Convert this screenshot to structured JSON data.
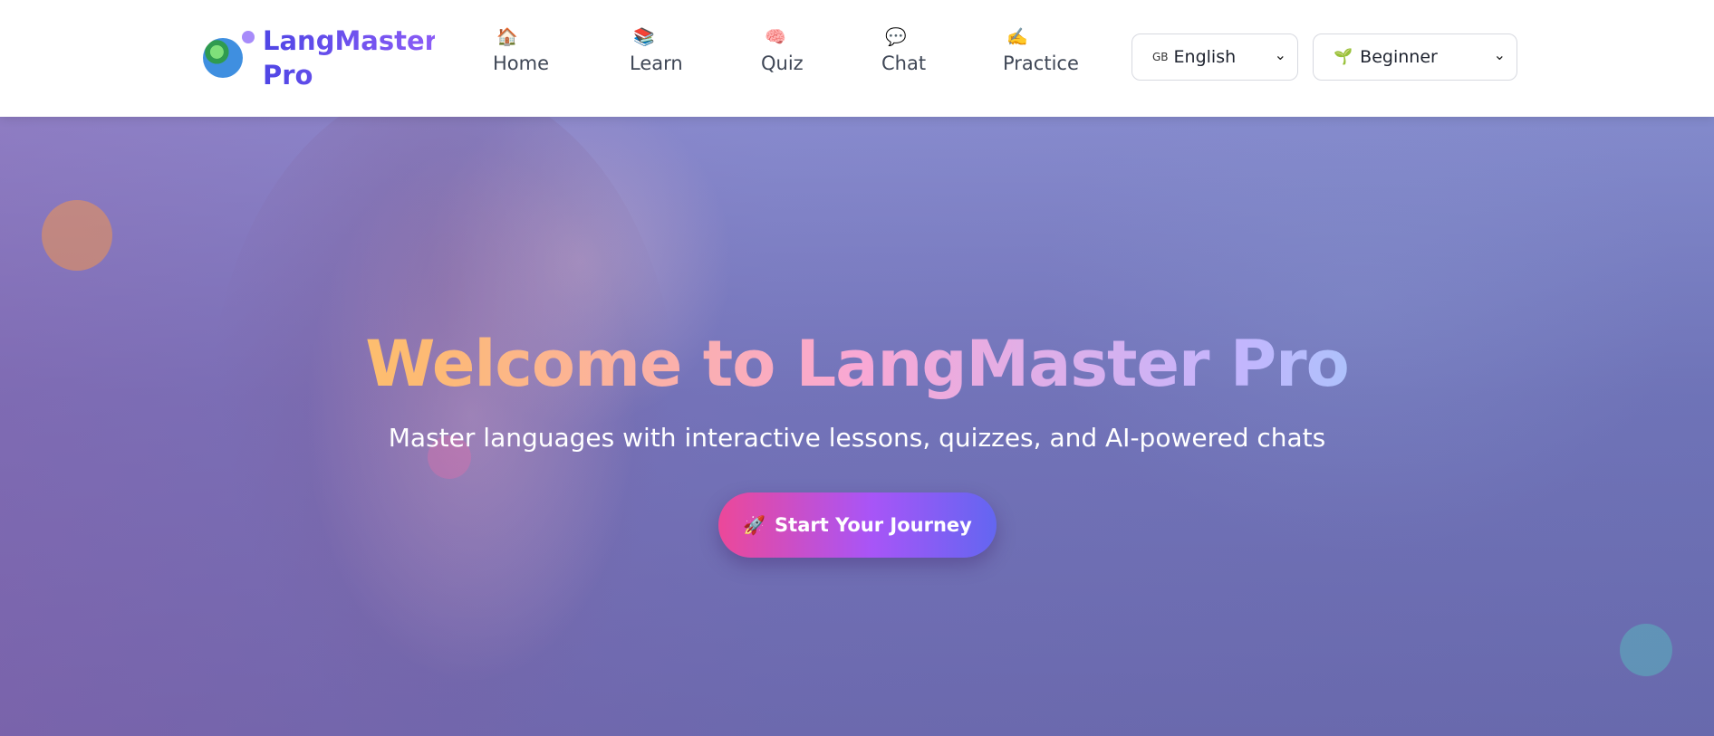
{
  "brand": {
    "name": "LangMaster Pro",
    "logo_icon": "globe-icon"
  },
  "nav": [
    {
      "icon": "🏠",
      "icon_name": "home-icon",
      "label": "Home"
    },
    {
      "icon": "📚",
      "icon_name": "books-icon",
      "label": "Learn"
    },
    {
      "icon": "🧠",
      "icon_name": "brain-icon",
      "label": "Quiz"
    },
    {
      "icon": "💬",
      "icon_name": "speech-bubble-icon",
      "label": "Chat"
    },
    {
      "icon": "✍️",
      "icon_name": "writing-hand-icon",
      "label": "Practice"
    }
  ],
  "language_select": {
    "flag_text": "GB",
    "value": "English"
  },
  "level_select": {
    "icon": "🌱",
    "value": "Beginner"
  },
  "hero": {
    "title": "Welcome to LangMaster Pro",
    "subtitle": "Master languages with interactive lessons, quizzes, and AI-powered chats",
    "cta_icon": "🚀",
    "cta_label": "Start Your Journey"
  },
  "colors": {
    "brand_gradient": [
      "#4f46e5",
      "#8b5cf6"
    ],
    "cta_gradient": [
      "#ec4899",
      "#a855f7",
      "#6366f1"
    ],
    "title_gradient": [
      "#fcd34d",
      "#fdba74",
      "#f9a8d4",
      "#c4b5fd",
      "#67e8f9"
    ],
    "hero_overlay": "#6e6fb0"
  }
}
